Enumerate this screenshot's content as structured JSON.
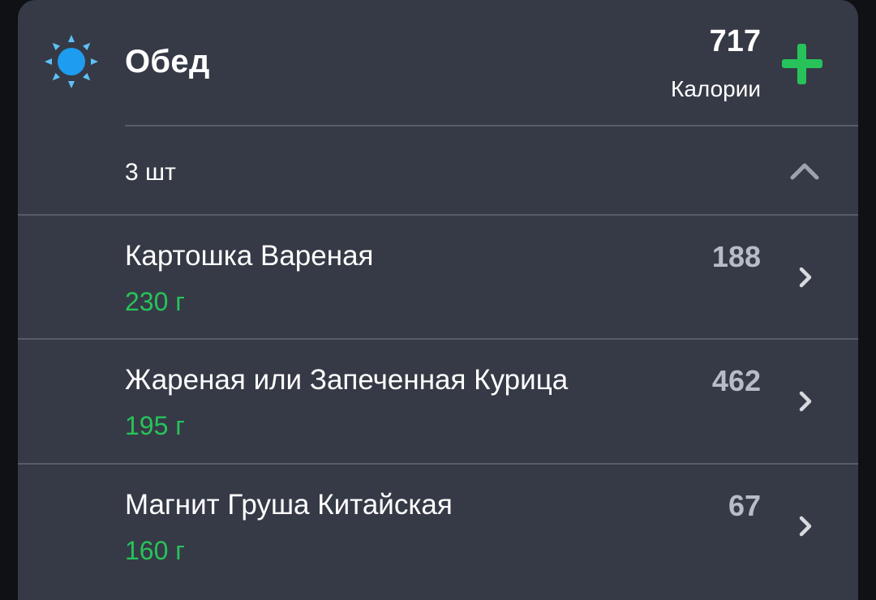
{
  "meal": {
    "title": "Обед",
    "icon": "sun-icon",
    "total_calories": "717",
    "calories_label": "Калории",
    "add_icon": "plus-icon",
    "accent_color": "#27c35a"
  },
  "summary": {
    "count_label": "3 шт",
    "toggle_icon": "chevron-up-icon"
  },
  "items": [
    {
      "name": "Картошка Вареная",
      "weight": "230 г",
      "calories": "188"
    },
    {
      "name": "Жареная или Запеченная Курица",
      "weight": "195 г",
      "calories": "462"
    },
    {
      "name": "Магнит Груша Китайская",
      "weight": "160 г",
      "calories": "67"
    }
  ]
}
